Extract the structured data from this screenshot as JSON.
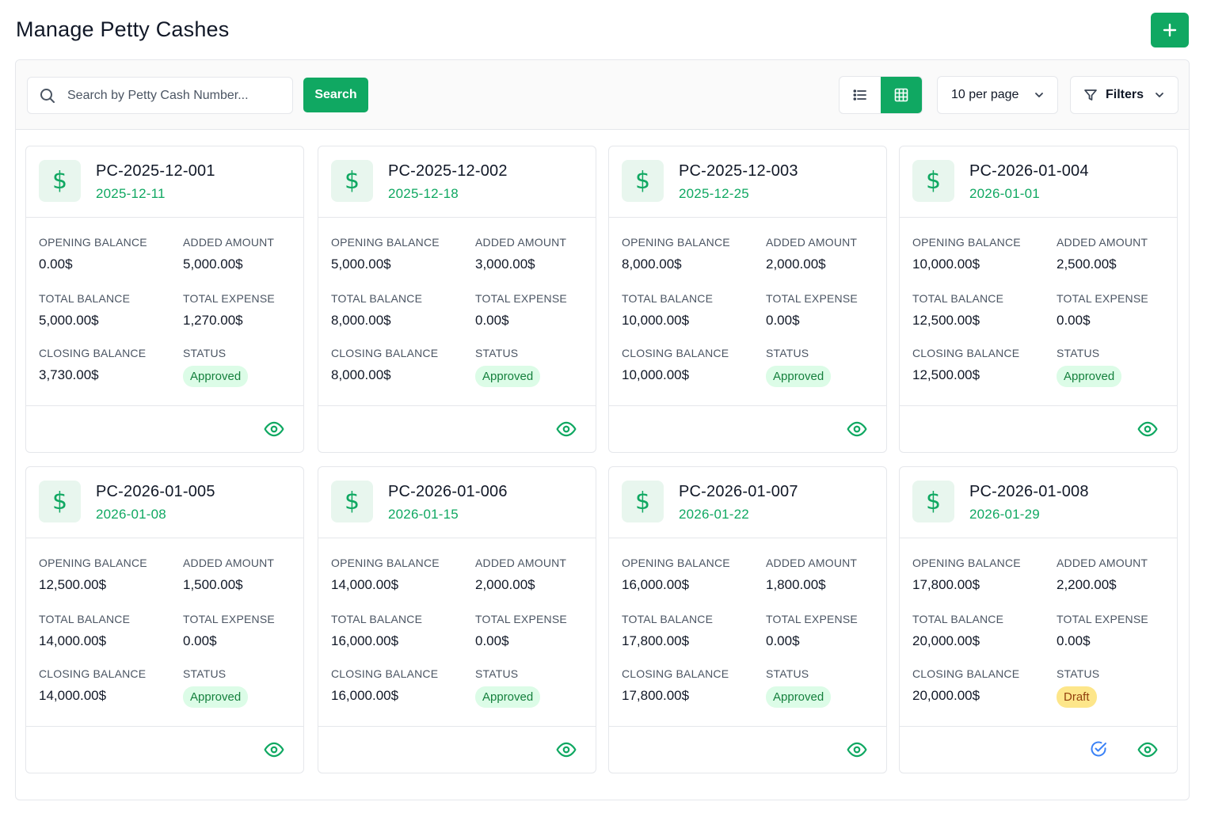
{
  "header": {
    "title": "Manage Petty Cashes",
    "add_icon": "plus-icon"
  },
  "toolbar": {
    "search_placeholder": "Search by Petty Cash Number...",
    "search_button": "Search",
    "per_page": "10 per page",
    "filters": "Filters",
    "active_view": "grid",
    "accent_color": "#10a862"
  },
  "labels": {
    "opening": "OPENING BALANCE",
    "added": "ADDED AMOUNT",
    "total_balance": "TOTAL BALANCE",
    "total_expense": "TOTAL EXPENSE",
    "closing": "CLOSING BALANCE",
    "status": "STATUS",
    "currency_symbol": "$"
  },
  "cards": [
    {
      "number": "PC-2025-12-001",
      "date": "2025-12-11",
      "opening": "0.00$",
      "added": "5,000.00$",
      "total_balance": "5,000.00$",
      "total_expense": "1,270.00$",
      "closing": "3,730.00$",
      "status": "Approved"
    },
    {
      "number": "PC-2025-12-002",
      "date": "2025-12-18",
      "opening": "5,000.00$",
      "added": "3,000.00$",
      "total_balance": "8,000.00$",
      "total_expense": "0.00$",
      "closing": "8,000.00$",
      "status": "Approved"
    },
    {
      "number": "PC-2025-12-003",
      "date": "2025-12-25",
      "opening": "8,000.00$",
      "added": "2,000.00$",
      "total_balance": "10,000.00$",
      "total_expense": "0.00$",
      "closing": "10,000.00$",
      "status": "Approved"
    },
    {
      "number": "PC-2026-01-004",
      "date": "2026-01-01",
      "opening": "10,000.00$",
      "added": "2,500.00$",
      "total_balance": "12,500.00$",
      "total_expense": "0.00$",
      "closing": "12,500.00$",
      "status": "Approved"
    },
    {
      "number": "PC-2026-01-005",
      "date": "2026-01-08",
      "opening": "12,500.00$",
      "added": "1,500.00$",
      "total_balance": "14,000.00$",
      "total_expense": "0.00$",
      "closing": "14,000.00$",
      "status": "Approved"
    },
    {
      "number": "PC-2026-01-006",
      "date": "2026-01-15",
      "opening": "14,000.00$",
      "added": "2,000.00$",
      "total_balance": "16,000.00$",
      "total_expense": "0.00$",
      "closing": "16,000.00$",
      "status": "Approved"
    },
    {
      "number": "PC-2026-01-007",
      "date": "2026-01-22",
      "opening": "16,000.00$",
      "added": "1,800.00$",
      "total_balance": "17,800.00$",
      "total_expense": "0.00$",
      "closing": "17,800.00$",
      "status": "Approved"
    },
    {
      "number": "PC-2026-01-008",
      "date": "2026-01-29",
      "opening": "17,800.00$",
      "added": "2,200.00$",
      "total_balance": "20,000.00$",
      "total_expense": "0.00$",
      "closing": "20,000.00$",
      "status": "Draft"
    }
  ]
}
